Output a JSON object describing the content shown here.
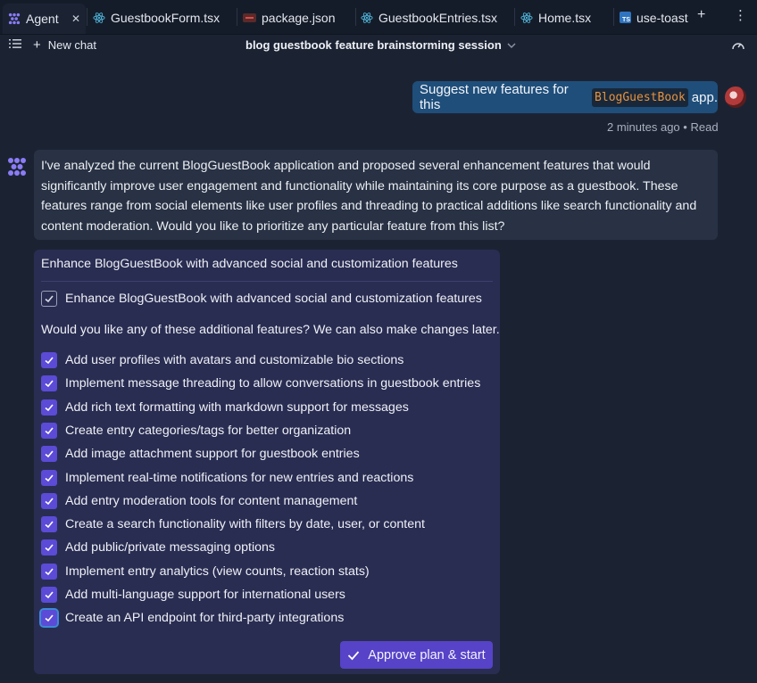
{
  "tabs": [
    {
      "label": "Agent",
      "icon": "agent-icon",
      "active": true
    },
    {
      "label": "GuestbookForm.tsx",
      "icon": "react-icon"
    },
    {
      "label": "package.json",
      "icon": "package-icon"
    },
    {
      "label": "GuestbookEntries.tsx",
      "icon": "react-icon"
    },
    {
      "label": "Home.tsx",
      "icon": "react-icon"
    },
    {
      "label": "use-toast",
      "icon": "typescript-icon"
    }
  ],
  "toolbar": {
    "new_chat_label": "New chat",
    "session_title": "blog guestbook feature brainstorming session"
  },
  "user_message": {
    "prefix": "Suggest new features for this",
    "code": "BlogGuestBook",
    "suffix": "app.",
    "meta_time": "2 minutes ago",
    "meta_sep": "•",
    "meta_status": "Read"
  },
  "agent_message": {
    "text": "I've analyzed the current BlogGuestBook application and proposed several enhancement features that would significantly improve user engagement and functionality while maintaining its core purpose as a guestbook. These features range from social elements like user profiles and threading to practical additions like search functionality and content moderation. Would you like to prioritize any particular feature from this list?"
  },
  "plan": {
    "title": "Enhance BlogGuestBook with advanced social and customization features",
    "main_item": "Enhance BlogGuestBook with advanced social and customization features",
    "question": "Would you like any of these additional features? We can also make changes later.",
    "features": [
      "Add user profiles with avatars and customizable bio sections",
      "Implement message threading to allow conversations in guestbook entries",
      "Add rich text formatting with markdown support for messages",
      "Create entry categories/tags for better organization",
      "Add image attachment support for guestbook entries",
      "Implement real-time notifications for new entries and reactions",
      "Add entry moderation tools for content management",
      "Create a search functionality with filters by date, user, or content",
      "Add public/private messaging options",
      "Implement entry analytics (view counts, reaction stats)",
      "Add multi-language support for international users",
      "Create an API endpoint for third-party integrations"
    ],
    "approve_label": "Approve plan & start"
  },
  "colors": {
    "background": "#1b2333",
    "accent": "#5b4bd6",
    "user_bubble": "#1f4e7a",
    "code_text": "#e8923f"
  }
}
